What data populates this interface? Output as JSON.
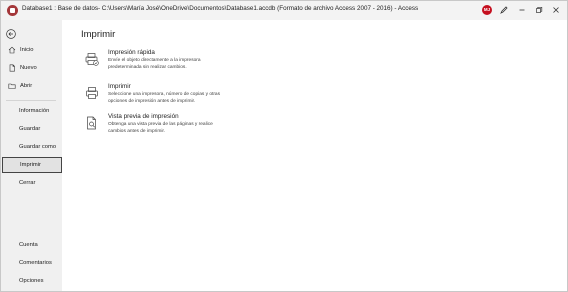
{
  "titlebar": {
    "title": "Database1 : Base de datos- C:\\Users\\María José\\OneDrive\\Documentos\\Database1.accdb (Formato de archivo Access 2007 - 2016)  -  Access",
    "avatar_initials": "MJ",
    "accent": "#a4373a"
  },
  "sidebar": {
    "back_icon": "back-arrow-icon",
    "top_items": [
      {
        "label": "Inicio",
        "icon": "home-icon"
      },
      {
        "label": "Nuevo",
        "icon": "new-document-icon"
      },
      {
        "label": "Abrir",
        "icon": "folder-icon"
      }
    ],
    "middle_items": [
      {
        "label": "Información"
      },
      {
        "label": "Guardar"
      },
      {
        "label": "Guardar como"
      },
      {
        "label": "Imprimir",
        "selected": true
      },
      {
        "label": "Cerrar"
      }
    ],
    "bottom_items": [
      {
        "label": "Cuenta"
      },
      {
        "label": "Comentarios"
      },
      {
        "label": "Opciones"
      }
    ]
  },
  "main": {
    "title": "Imprimir",
    "options": [
      {
        "title": "Impresión rápida",
        "desc_line1": "Envíe el objeto directamente a la impresora",
        "desc_line2": "predeterminada sin realizar cambios.",
        "icon": "quick-print-icon"
      },
      {
        "title": "Imprimir",
        "desc_line1": "Seleccione una impresora, número de copias y otras",
        "desc_line2": "opciones de impresión antes de imprimir.",
        "icon": "printer-icon"
      },
      {
        "title": "Vista previa de impresión",
        "desc_line1": "Obtenga una vista previa de las páginas y realice",
        "desc_line2": "cambios antes de imprimir.",
        "icon": "print-preview-icon"
      }
    ]
  }
}
